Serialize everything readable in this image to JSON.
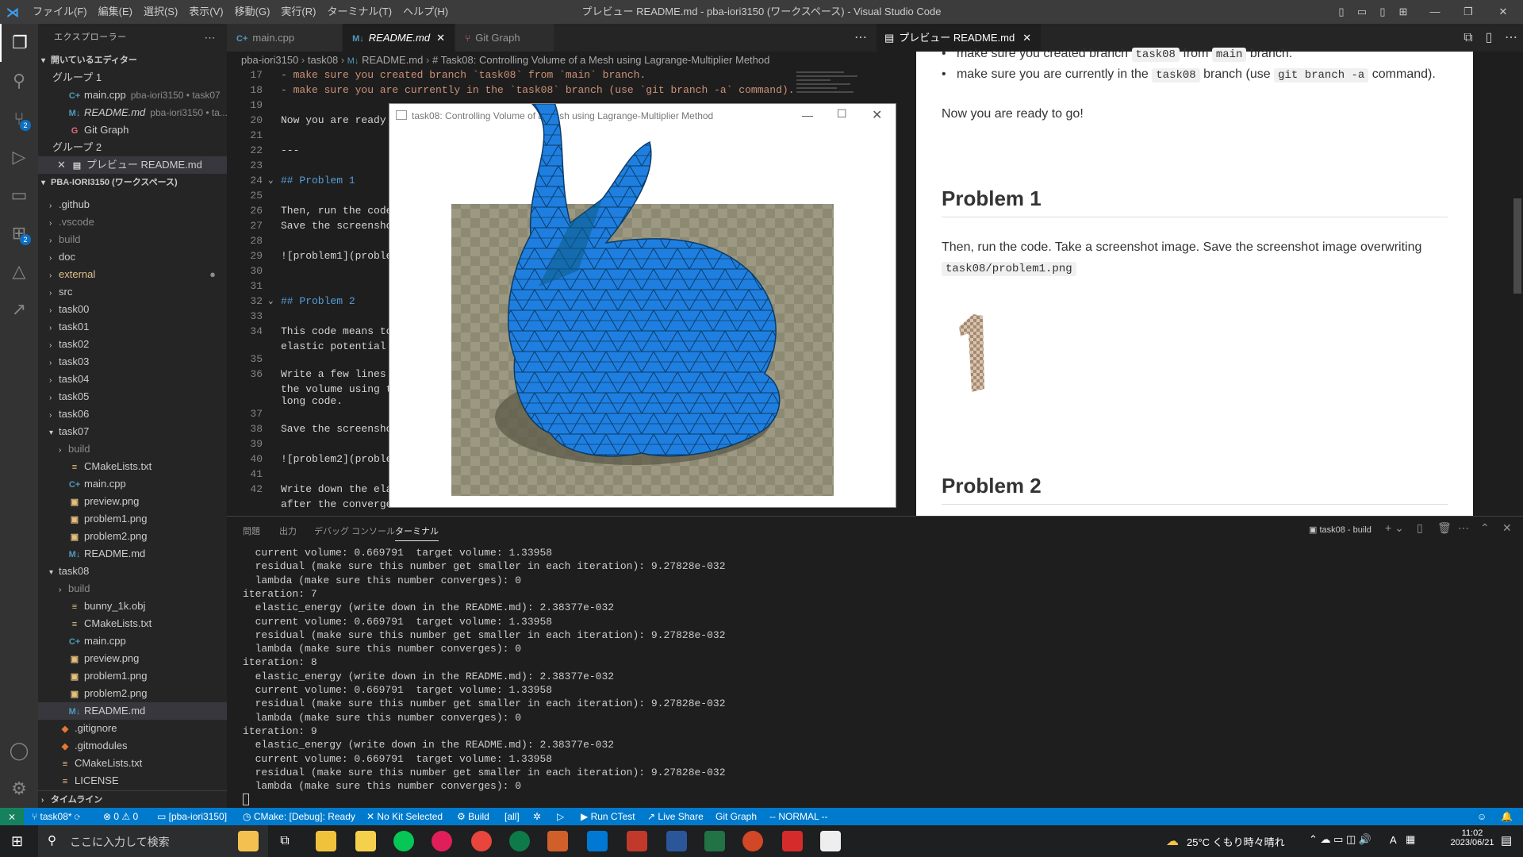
{
  "titlebar": {
    "menus": [
      "ファイル(F)",
      "編集(E)",
      "選択(S)",
      "表示(V)",
      "移動(G)",
      "実行(R)",
      "ターミナル(T)",
      "ヘルプ(H)"
    ],
    "window_title": "プレビュー README.md - pba-iori3150 (ワークスペース) - Visual Studio Code"
  },
  "activity": {
    "badge_scm": "2",
    "badge_ext": "2"
  },
  "sidebar": {
    "header": "エクスプローラー",
    "open_editors_label": "開いているエディター",
    "group1": "グループ 1",
    "group1_items": [
      {
        "icon": "C+",
        "name": "main.cpp",
        "desc": "pba-iori3150 • task07"
      },
      {
        "icon": "M↓",
        "name": "README.md",
        "desc": "pba-iori3150 • ta..."
      },
      {
        "icon": "G",
        "name": "Git Graph",
        "desc": ""
      }
    ],
    "group2": "グループ 2",
    "group2_item": "プレビュー README.md",
    "workspace_label": "PBA-IORI3150 (ワークスペース)",
    "tree": [
      {
        "name": ".github",
        "indent": 1,
        "type": "folder",
        "color": "#ccc"
      },
      {
        "name": ".vscode",
        "indent": 1,
        "type": "folder",
        "color": "#8b8b8b"
      },
      {
        "name": "build",
        "indent": 1,
        "type": "folder",
        "color": "#8b8b8b"
      },
      {
        "name": "doc",
        "indent": 1,
        "type": "folder",
        "color": "#ccc"
      },
      {
        "name": "external",
        "indent": 1,
        "type": "folder",
        "color": "#e2c08d"
      },
      {
        "name": "src",
        "indent": 1,
        "type": "folder",
        "color": "#ccc"
      },
      {
        "name": "task00",
        "indent": 1,
        "type": "folder",
        "color": "#ccc"
      },
      {
        "name": "task01",
        "indent": 1,
        "type": "folder",
        "color": "#ccc"
      },
      {
        "name": "task02",
        "indent": 1,
        "type": "folder",
        "color": "#ccc"
      },
      {
        "name": "task03",
        "indent": 1,
        "type": "folder",
        "color": "#ccc"
      },
      {
        "name": "task04",
        "indent": 1,
        "type": "folder",
        "color": "#ccc"
      },
      {
        "name": "task05",
        "indent": 1,
        "type": "folder",
        "color": "#ccc"
      },
      {
        "name": "task06",
        "indent": 1,
        "type": "folder",
        "color": "#ccc"
      },
      {
        "name": "task07",
        "indent": 1,
        "type": "open",
        "color": "#ccc"
      },
      {
        "name": "build",
        "indent": 2,
        "type": "folder",
        "color": "#8b8b8b"
      },
      {
        "name": "CMakeLists.txt",
        "indent": 2,
        "type": "file",
        "icon": "≡",
        "iconcolor": "#e5c07b",
        "color": "#ccc"
      },
      {
        "name": "main.cpp",
        "indent": 2,
        "type": "file",
        "icon": "C+",
        "iconcolor": "#519aba",
        "color": "#ccc"
      },
      {
        "name": "preview.png",
        "indent": 2,
        "type": "file",
        "icon": "▣",
        "iconcolor": "#e5c07b",
        "color": "#ccc"
      },
      {
        "name": "problem1.png",
        "indent": 2,
        "type": "file",
        "icon": "▣",
        "iconcolor": "#e5c07b",
        "color": "#ccc"
      },
      {
        "name": "problem2.png",
        "indent": 2,
        "type": "file",
        "icon": "▣",
        "iconcolor": "#e5c07b",
        "color": "#ccc"
      },
      {
        "name": "README.md",
        "indent": 2,
        "type": "file",
        "icon": "M↓",
        "iconcolor": "#519aba",
        "color": "#ccc"
      },
      {
        "name": "task08",
        "indent": 1,
        "type": "open",
        "color": "#ccc"
      },
      {
        "name": "build",
        "indent": 2,
        "type": "folder",
        "color": "#8b8b8b"
      },
      {
        "name": "bunny_1k.obj",
        "indent": 2,
        "type": "file",
        "icon": "≡",
        "iconcolor": "#e5c07b",
        "color": "#ccc"
      },
      {
        "name": "CMakeLists.txt",
        "indent": 2,
        "type": "file",
        "icon": "≡",
        "iconcolor": "#e5c07b",
        "color": "#ccc"
      },
      {
        "name": "main.cpp",
        "indent": 2,
        "type": "file",
        "icon": "C+",
        "iconcolor": "#519aba",
        "color": "#ccc"
      },
      {
        "name": "preview.png",
        "indent": 2,
        "type": "file",
        "icon": "▣",
        "iconcolor": "#e5c07b",
        "color": "#ccc"
      },
      {
        "name": "problem1.png",
        "indent": 2,
        "type": "file",
        "icon": "▣",
        "iconcolor": "#e5c07b",
        "color": "#ccc"
      },
      {
        "name": "problem2.png",
        "indent": 2,
        "type": "file",
        "icon": "▣",
        "iconcolor": "#e5c07b",
        "color": "#ccc"
      },
      {
        "name": "README.md",
        "indent": 2,
        "type": "file",
        "icon": "M↓",
        "iconcolor": "#519aba",
        "color": "#ccc",
        "selected": true
      },
      {
        "name": ".gitignore",
        "indent": 1,
        "type": "file",
        "icon": "◆",
        "iconcolor": "#e37933",
        "color": "#ccc"
      },
      {
        "name": ".gitmodules",
        "indent": 1,
        "type": "file",
        "icon": "◆",
        "iconcolor": "#e37933",
        "color": "#ccc"
      },
      {
        "name": "CMakeLists.txt",
        "indent": 1,
        "type": "file",
        "icon": "≡",
        "iconcolor": "#e5c07b",
        "color": "#ccc"
      },
      {
        "name": "LICENSE",
        "indent": 1,
        "type": "file",
        "icon": "≡",
        "iconcolor": "#e5c07b",
        "color": "#ccc"
      }
    ],
    "timeline": "タイムライン"
  },
  "editor": {
    "tabs": [
      "main.cpp",
      "README.md",
      "Git Graph"
    ],
    "breadcrumb": [
      "pba-iori3150",
      "task08",
      "README.md",
      "# Task08: Controlling Volume of a Mesh using Lagrange-Multiplier Method"
    ],
    "lines": [
      {
        "n": "17",
        "t": "- make sure you created branch `task08` from `main` branch.",
        "c": "#ce9178"
      },
      {
        "n": "18",
        "t": "- make sure you are currently in the `task08` branch (use `git branch -a` command).",
        "c": "#ce9178"
      },
      {
        "n": "19",
        "t": "",
        "c": "#d4d4d4"
      },
      {
        "n": "20",
        "t": "Now you are ready to go!",
        "c": "#d4d4d4"
      },
      {
        "n": "21",
        "t": "",
        "c": "#d4d4d4"
      },
      {
        "n": "22",
        "t": "---",
        "c": "#d4d4d4"
      },
      {
        "n": "23",
        "t": "",
        "c": "#d4d4d4"
      },
      {
        "n": "24",
        "t": "## Problem 1",
        "c": "#569cd6"
      },
      {
        "n": "25",
        "t": "",
        "c": "#d4d4d4"
      },
      {
        "n": "26",
        "t": "Then, run the code",
        "c": "#d4d4d4"
      },
      {
        "n": "27",
        "t": "Save the screensho",
        "c": "#d4d4d4"
      },
      {
        "n": "28",
        "t": "",
        "c": "#d4d4d4"
      },
      {
        "n": "29",
        "t": "![problem1](proble",
        "c": "#d4d4d4"
      },
      {
        "n": "30",
        "t": "",
        "c": "#d4d4d4"
      },
      {
        "n": "31",
        "t": "",
        "c": "#d4d4d4"
      },
      {
        "n": "32",
        "t": "## Problem 2",
        "c": "#569cd6"
      },
      {
        "n": "33",
        "t": "",
        "c": "#d4d4d4"
      },
      {
        "n": "34",
        "t": "This code means to",
        "c": "#d4d4d4"
      },
      {
        "n": "",
        "t": "elastic potential",
        "c": "#d4d4d4"
      },
      {
        "n": "35",
        "t": "",
        "c": "#d4d4d4"
      },
      {
        "n": "36",
        "t": "Write a few lines",
        "c": "#d4d4d4"
      },
      {
        "n": "",
        "t": "the volume using t",
        "c": "#d4d4d4"
      },
      {
        "n": "",
        "t": "long code.",
        "c": "#d4d4d4"
      },
      {
        "n": "37",
        "t": "",
        "c": "#d4d4d4"
      },
      {
        "n": "38",
        "t": "Save the screensho",
        "c": "#d4d4d4"
      },
      {
        "n": "39",
        "t": "",
        "c": "#d4d4d4"
      },
      {
        "n": "40",
        "t": "![problem2](proble",
        "c": "#d4d4d4"
      },
      {
        "n": "41",
        "t": "",
        "c": "#d4d4d4"
      },
      {
        "n": "42",
        "t": "Write down the ela",
        "c": "#d4d4d4"
      },
      {
        "n": "",
        "t": "after the convergence below:",
        "c": "#d4d4d4"
      }
    ]
  },
  "glwindow": {
    "title": "task08: Controlling Volume of a Mesh using Lagrange-Multiplier Method"
  },
  "preview": {
    "tab": "プレビュー README.md",
    "bullet1_a": "make sure you created branch",
    "bullet1_code1": "task08",
    "bullet1_b": "from",
    "bullet1_code2": "main",
    "bullet1_c": "branch.",
    "bullet2_a": "make sure you are currently in the",
    "bullet2_code1": "task08",
    "bullet2_b": "branch (use",
    "bullet2_code2": "git branch -a",
    "bullet2_c": "command).",
    "ready": "Now you are ready to go!",
    "h1": "Problem 1",
    "p1": "Then, run the code. Take a screenshot image. Save the screenshot image overwriting",
    "p1_code": "task08/problem1.png",
    "h2": "Problem 2"
  },
  "panel": {
    "tabs": [
      "問題",
      "出力",
      "デバッグ コンソール",
      "ターミナル"
    ],
    "terminal_name": "task08 - build",
    "lines": [
      "  current volume: 0.669791  target volume: 1.33958",
      "  residual (make sure this number get smaller in each iteration): 9.27828e-032",
      "  lambda (make sure this number converges): 0",
      "iteration: 7",
      "  elastic_energy (write down in the README.md): 2.38377e-032",
      "  current volume: 0.669791  target volume: 1.33958",
      "  residual (make sure this number get smaller in each iteration): 9.27828e-032",
      "  lambda (make sure this number converges): 0",
      "iteration: 8",
      "  elastic_energy (write down in the README.md): 2.38377e-032",
      "  current volume: 0.669791  target volume: 1.33958",
      "  residual (make sure this number get smaller in each iteration): 9.27828e-032",
      "  lambda (make sure this number converges): 0",
      "iteration: 9",
      "  elastic_energy (write down in the README.md): 2.38377e-032",
      "  current volume: 0.669791  target volume: 1.33958",
      "  residual (make sure this number get smaller in each iteration): 9.27828e-032",
      "  lambda (make sure this number converges): 0"
    ]
  },
  "status": {
    "branch": "task08*",
    "problems": "⊗ 0 ⚠ 0",
    "folder": "[pba-iori3150]",
    "cmake": "CMake: [Debug]: Ready",
    "kit": "No Kit Selected",
    "build": "Build",
    "all": "[all]",
    "ctest": "Run CTest",
    "liveshare": "Live Share",
    "gitgraph": "Git Graph",
    "vim": "-- NORMAL --"
  },
  "taskbar": {
    "search": "ここに入力して検索",
    "weather": "25°C くもり時々晴れ",
    "ime": "A",
    "time": "11:02",
    "date": "2023/06/21"
  },
  "colors": {
    "accent": "#007acc",
    "mesh": "#1e7bd6"
  }
}
